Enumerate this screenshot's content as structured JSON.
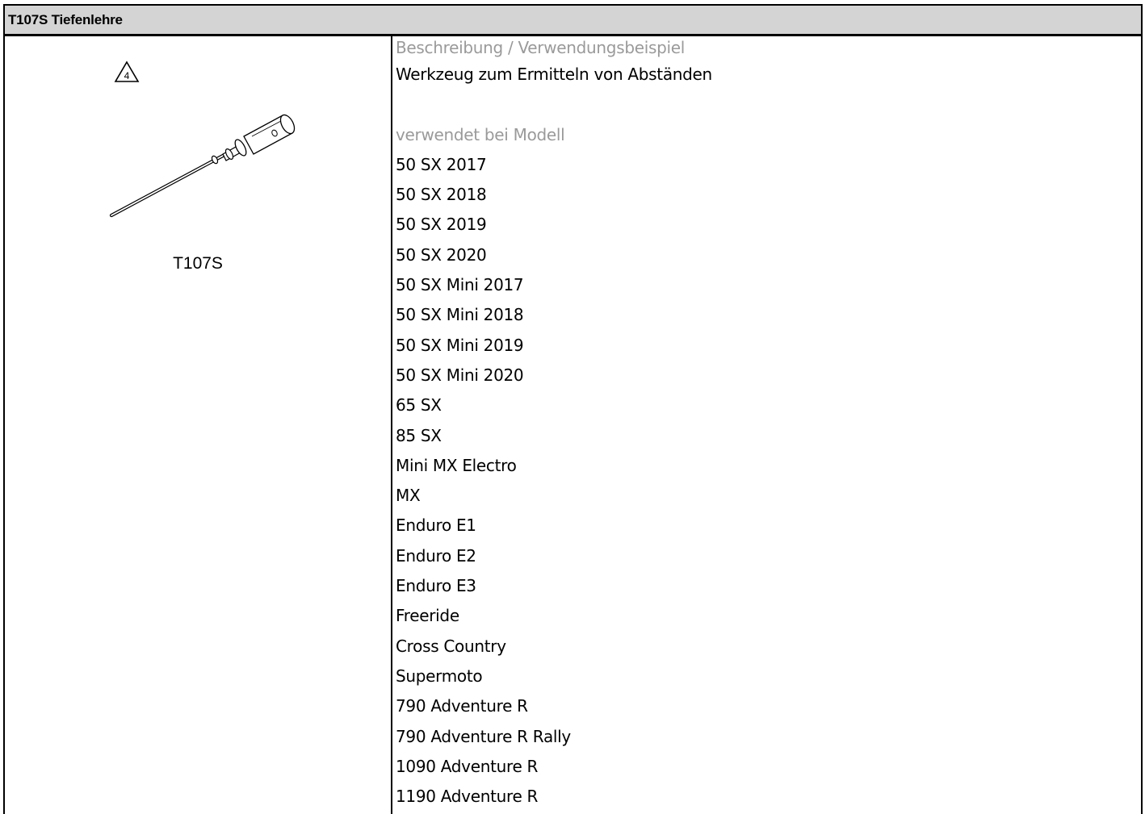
{
  "header": {
    "title": "T107S Tiefenlehre"
  },
  "tool": {
    "icon": "warning-triangle-4-icon",
    "warning_number": "4",
    "label": "T107S"
  },
  "description": {
    "heading": "Beschreibung / Verwendungsbeispiel",
    "text": "Werkzeug zum Ermitteln von Abständen"
  },
  "models": {
    "heading": "verwendet bei Modell",
    "items": [
      "50 SX 2017",
      "50 SX 2018",
      "50 SX 2019",
      "50 SX 2020",
      "50 SX Mini 2017",
      "50 SX Mini 2018",
      "50 SX Mini 2019",
      "50 SX Mini 2020",
      "65 SX",
      "85 SX",
      "Mini MX Electro",
      "MX",
      "Enduro E1",
      "Enduro E2",
      "Enduro E3",
      "Freeride",
      "Cross Country",
      "Supermoto",
      "790 Adventure R",
      "790 Adventure R Rally",
      "1090 Adventure R",
      "1190 Adventure R"
    ]
  },
  "colors": {
    "header_bg": "#d4d4d4",
    "muted_text": "#9a9a9a",
    "text": "#000000"
  }
}
